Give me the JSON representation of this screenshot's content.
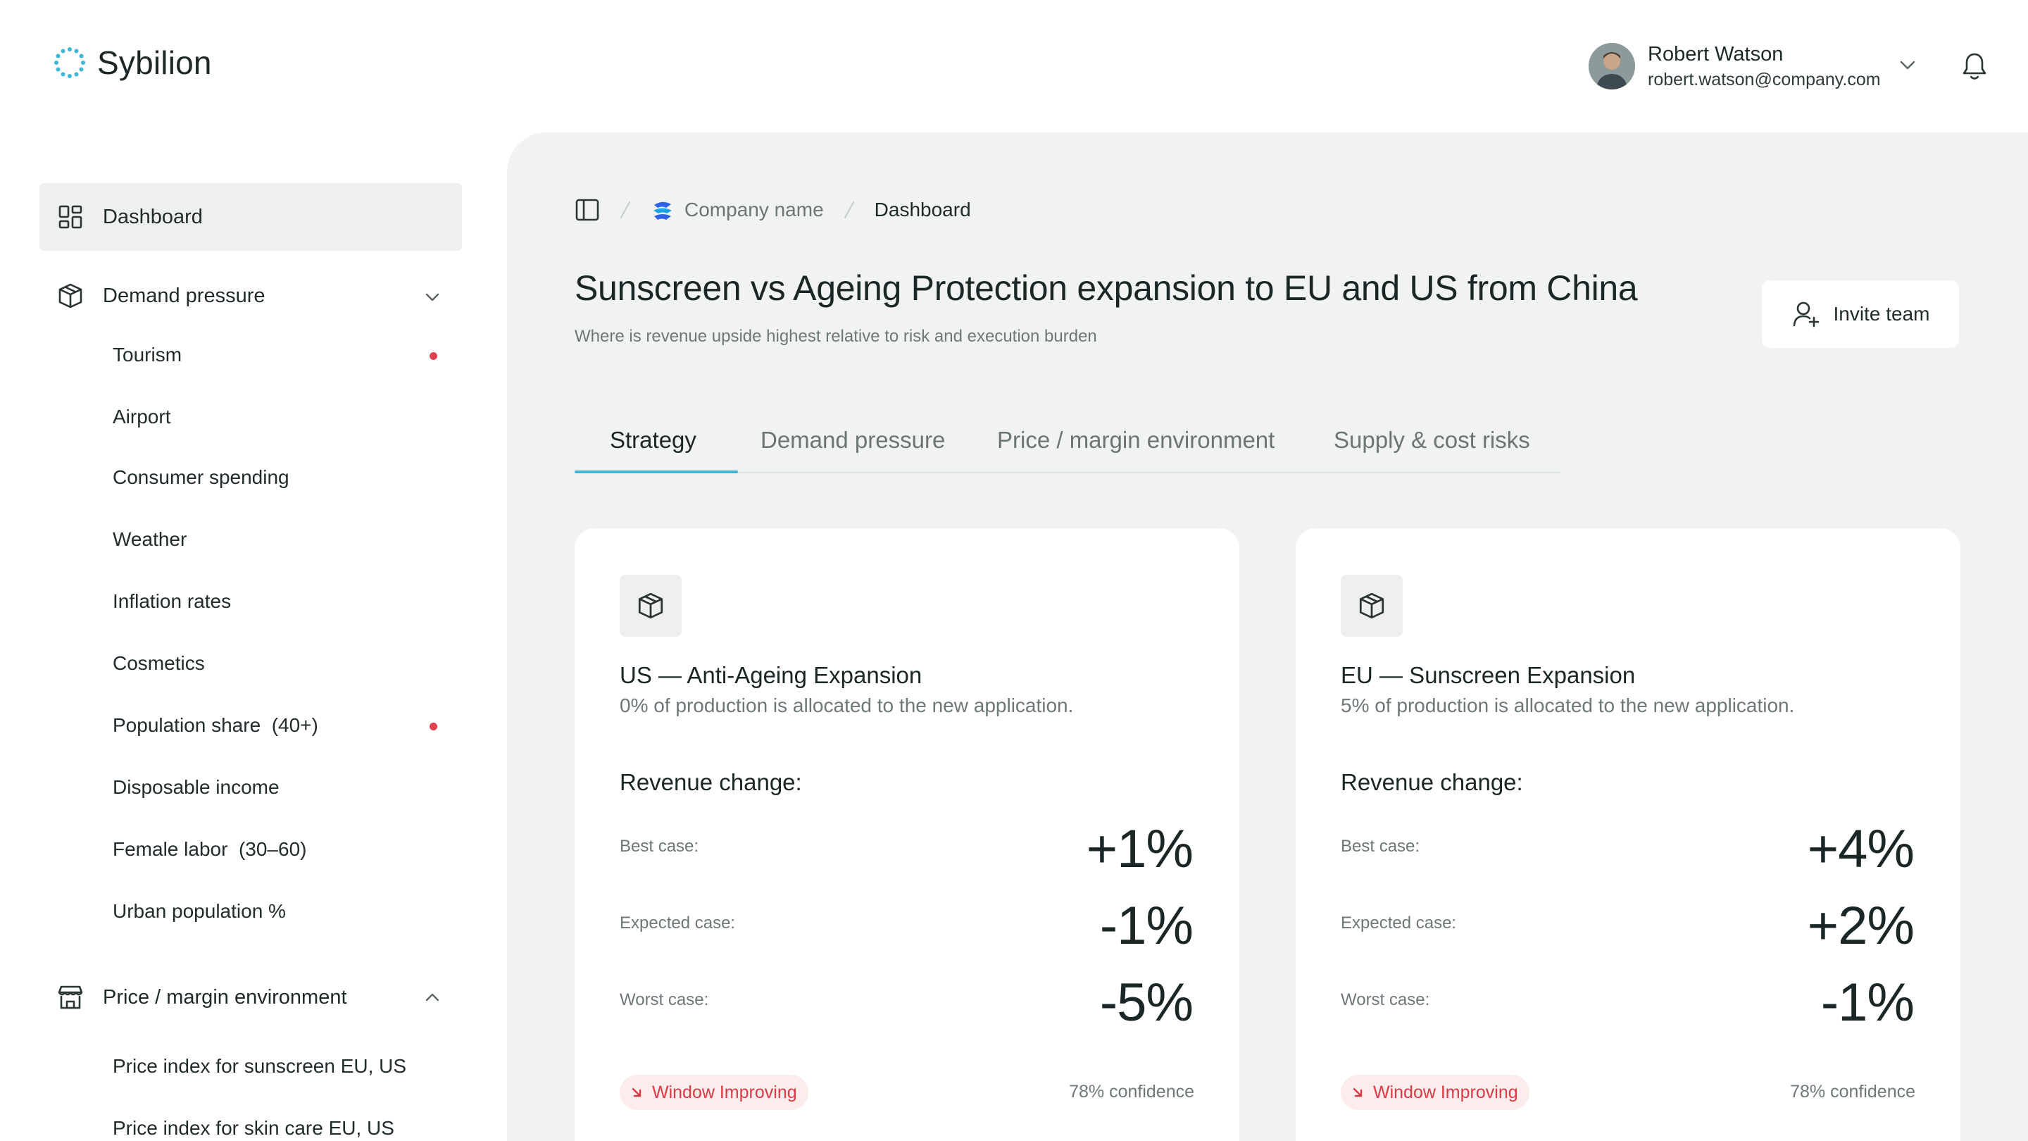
{
  "brand": {
    "name": "Sybilion"
  },
  "user": {
    "name": "Robert Watson",
    "email": "robert.watson@company.com"
  },
  "sidebar": {
    "dashboard": "Dashboard",
    "demand": {
      "label": "Demand pressure",
      "items": [
        {
          "label": "Tourism",
          "alert": true
        },
        {
          "label": "Airport",
          "alert": false
        },
        {
          "label": "Consumer spending",
          "alert": false
        },
        {
          "label": "Weather",
          "alert": false
        },
        {
          "label": "Inflation rates",
          "alert": false
        },
        {
          "label": "Cosmetics",
          "alert": false
        },
        {
          "label": "Population share  (40+)",
          "alert": true
        },
        {
          "label": "Disposable income",
          "alert": false
        },
        {
          "label": "Female labor  (30–60)",
          "alert": false
        },
        {
          "label": "Urban population %",
          "alert": false
        }
      ]
    },
    "price": {
      "label": "Price / margin environment",
      "items": [
        {
          "label": "Price index for sunscreen EU, US"
        },
        {
          "label": "Price index for skin care EU, US"
        }
      ]
    }
  },
  "breadcrumb": {
    "company": "Company name",
    "current": "Dashboard"
  },
  "page": {
    "title": "Sunscreen vs Ageing Protection expansion to EU and US from China",
    "subtitle": "Where is revenue upside highest relative to risk and execution burden"
  },
  "invite_label": "Invite team",
  "tabs": [
    "Strategy",
    "Demand pressure",
    "Price / margin environment",
    "Supply & cost risks"
  ],
  "active_tab": "Strategy",
  "cards": [
    {
      "title": "US — Anti-Ageing Expansion",
      "description": "0% of production is allocated to the new application.",
      "revenue_label": "Revenue change:",
      "best_label": "Best case:",
      "best": "+1%",
      "expected_label": "Expected case:",
      "expected": "-1%",
      "worst_label": "Worst case:",
      "worst": "-5%",
      "badge": "Window Improving",
      "confidence": "78% confidence"
    },
    {
      "title": "EU — Sunscreen Expansion",
      "description": "5% of production is allocated to the new application.",
      "revenue_label": "Revenue change:",
      "best_label": "Best case:",
      "best": "+4%",
      "expected_label": "Expected case:",
      "expected": "+2%",
      "worst_label": "Worst case:",
      "worst": "-1%",
      "badge": "Window Improving",
      "confidence": "78% confidence"
    }
  ],
  "colors": {
    "accent": "#3fb6d4",
    "alert": "#e0404f",
    "badge_bg": "#fdecec",
    "panel_bg": "#f1f3f3"
  },
  "icons": [
    "logo-icon",
    "chevron-down-icon",
    "bell-icon",
    "dashboard-grid-icon",
    "box-icon",
    "store-icon",
    "chevron-up-icon",
    "sidebar-toggle-icon",
    "company-logo-icon",
    "add-user-icon",
    "arrow-down-right-icon"
  ]
}
